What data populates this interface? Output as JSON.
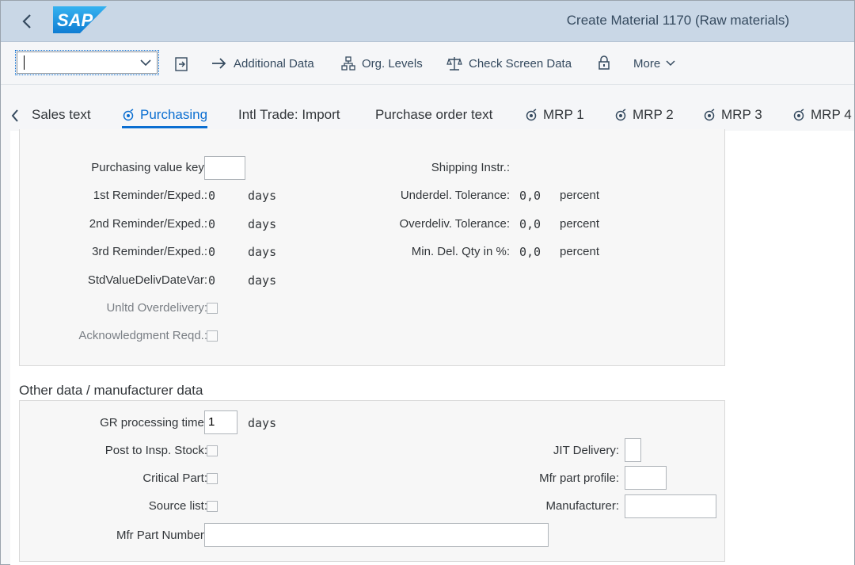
{
  "header": {
    "title": "Create Material 1170 (Raw materials)",
    "logo_text": "SAP"
  },
  "toolbar": {
    "command_value": "",
    "additional_data": "Additional Data",
    "org_levels": "Org. Levels",
    "check_screen_data": "Check Screen Data",
    "more": "More"
  },
  "tabs": [
    {
      "label": "Sales text",
      "icon": "none"
    },
    {
      "label": "Purchasing",
      "icon": "filled-circle-icon",
      "active": true
    },
    {
      "label": "Intl Trade: Import",
      "icon": "none"
    },
    {
      "label": "Purchase order text",
      "icon": "none"
    },
    {
      "label": "MRP 1",
      "icon": "filled-circle-icon"
    },
    {
      "label": "MRP 2",
      "icon": "filled-circle-icon"
    },
    {
      "label": "MRP 3",
      "icon": "filled-circle-icon"
    },
    {
      "label": "MRP 4",
      "icon": "filled-circle-icon"
    }
  ],
  "purchasing": {
    "purchasing_value_key": {
      "label": "Purchasing value key:",
      "value": ""
    },
    "reminder1": {
      "label": "1st Reminder/Exped.:",
      "value": "0",
      "unit": "days"
    },
    "reminder2": {
      "label": "2nd Reminder/Exped.:",
      "value": "0",
      "unit": "days"
    },
    "reminder3": {
      "label": "3rd Reminder/Exped.:",
      "value": "0",
      "unit": "days"
    },
    "std_value": {
      "label": "StdValueDelivDateVar:",
      "value": "0",
      "unit": "days"
    },
    "unltd_overdelivery": {
      "label": "Unltd Overdelivery:",
      "checked": false
    },
    "ack_reqd": {
      "label": "Acknowledgment Reqd.:",
      "checked": false
    },
    "shipping_instr": {
      "label": "Shipping Instr.:",
      "value": ""
    },
    "underdel": {
      "label": "Underdel. Tolerance:",
      "value": "0,0",
      "unit": "percent"
    },
    "overdeliv": {
      "label": "Overdeliv. Tolerance:",
      "value": "0,0",
      "unit": "percent"
    },
    "min_del": {
      "label": "Min. Del. Qty in %:",
      "value": "0,0",
      "unit": "percent"
    }
  },
  "other": {
    "title": "Other data / manufacturer data",
    "gr_time": {
      "label": "GR processing time:",
      "value": "1",
      "unit": "days"
    },
    "post_insp": {
      "label": "Post to Insp. Stock:",
      "checked": false
    },
    "critical": {
      "label": "Critical Part:",
      "checked": false
    },
    "source_list": {
      "label": "Source list:",
      "checked": false
    },
    "mfr_part_number": {
      "label": "Mfr Part Number:",
      "value": ""
    },
    "jit": {
      "label": "JIT Delivery:",
      "value": ""
    },
    "mfr_profile": {
      "label": "Mfr part profile:",
      "value": ""
    },
    "manufacturer": {
      "label": "Manufacturer:",
      "value": ""
    }
  },
  "colors": {
    "header_bg": "#c9d7e6",
    "accent": "#0a6ed1",
    "sap_logo": "#1a9ae0"
  }
}
